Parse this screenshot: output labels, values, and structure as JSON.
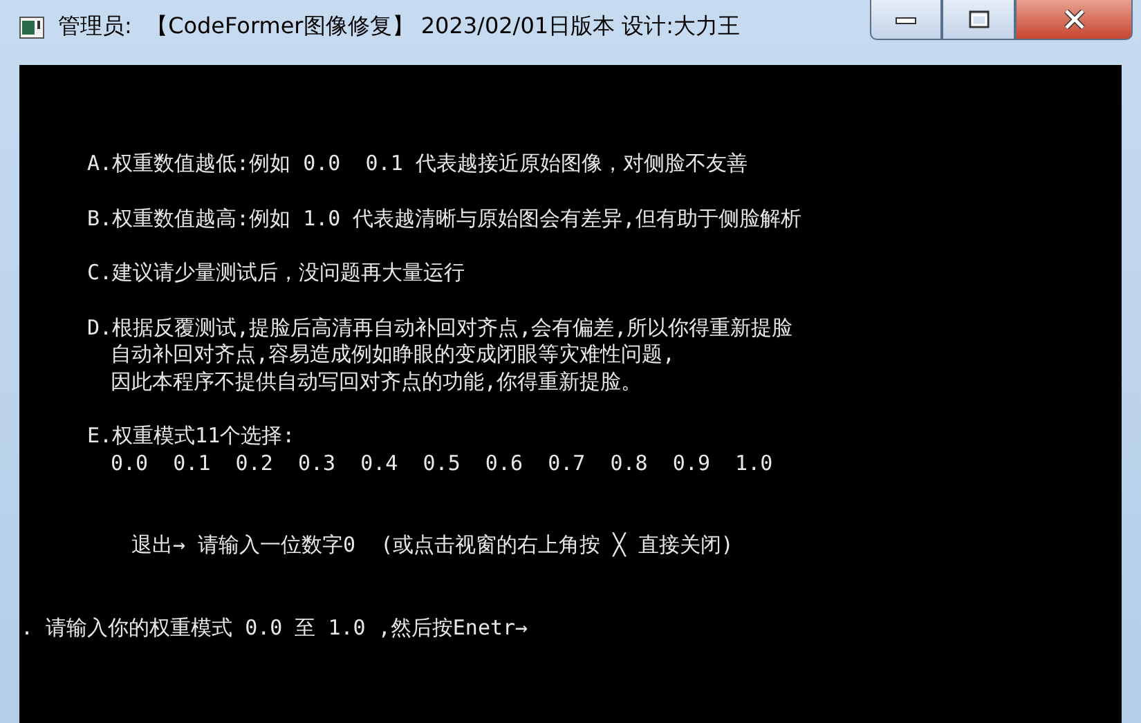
{
  "window": {
    "title": "管理员:  【CodeFormer图像修复】 2023/02/01日版本 设计:大力王"
  },
  "console": {
    "blocks": [
      {
        "kind": "note",
        "lines": [
          "A.权重数值越低:例如 0.0  0.1 代表越接近原始图像，对侧脸不友善"
        ]
      },
      {
        "kind": "note",
        "lines": [
          "B.权重数值越高:例如 1.0 代表越清晰与原始图会有差异,但有助于侧脸解析"
        ]
      },
      {
        "kind": "note",
        "lines": [
          "C.建议请少量测试后，没问题再大量运行"
        ]
      },
      {
        "kind": "note",
        "lines": [
          "D.根据反覆测试,提脸后高清再自动补回对齐点,会有偏差,所以你得重新提脸",
          "自动补回对齐点,容易造成例如睁眼的变成闭眼等灾难性问题,",
          "因此本程序不提供自动写回对齐点的功能,你得重新提脸。"
        ]
      },
      {
        "kind": "note",
        "lines": [
          "E.权重模式11个选择:",
          "0.0  0.1  0.2  0.3  0.4  0.5  0.6  0.7  0.8  0.9  1.0"
        ]
      },
      {
        "kind": "exit",
        "lines": [
          "退出→ 请输入一位数字0  (或点击视窗的右上角按 ╳ 直接关闭)"
        ]
      },
      {
        "kind": "prompt",
        "lines": [
          ". 请输入你的权重模式 0.0 至 1.0 ,然后按Enetr→"
        ]
      }
    ]
  }
}
